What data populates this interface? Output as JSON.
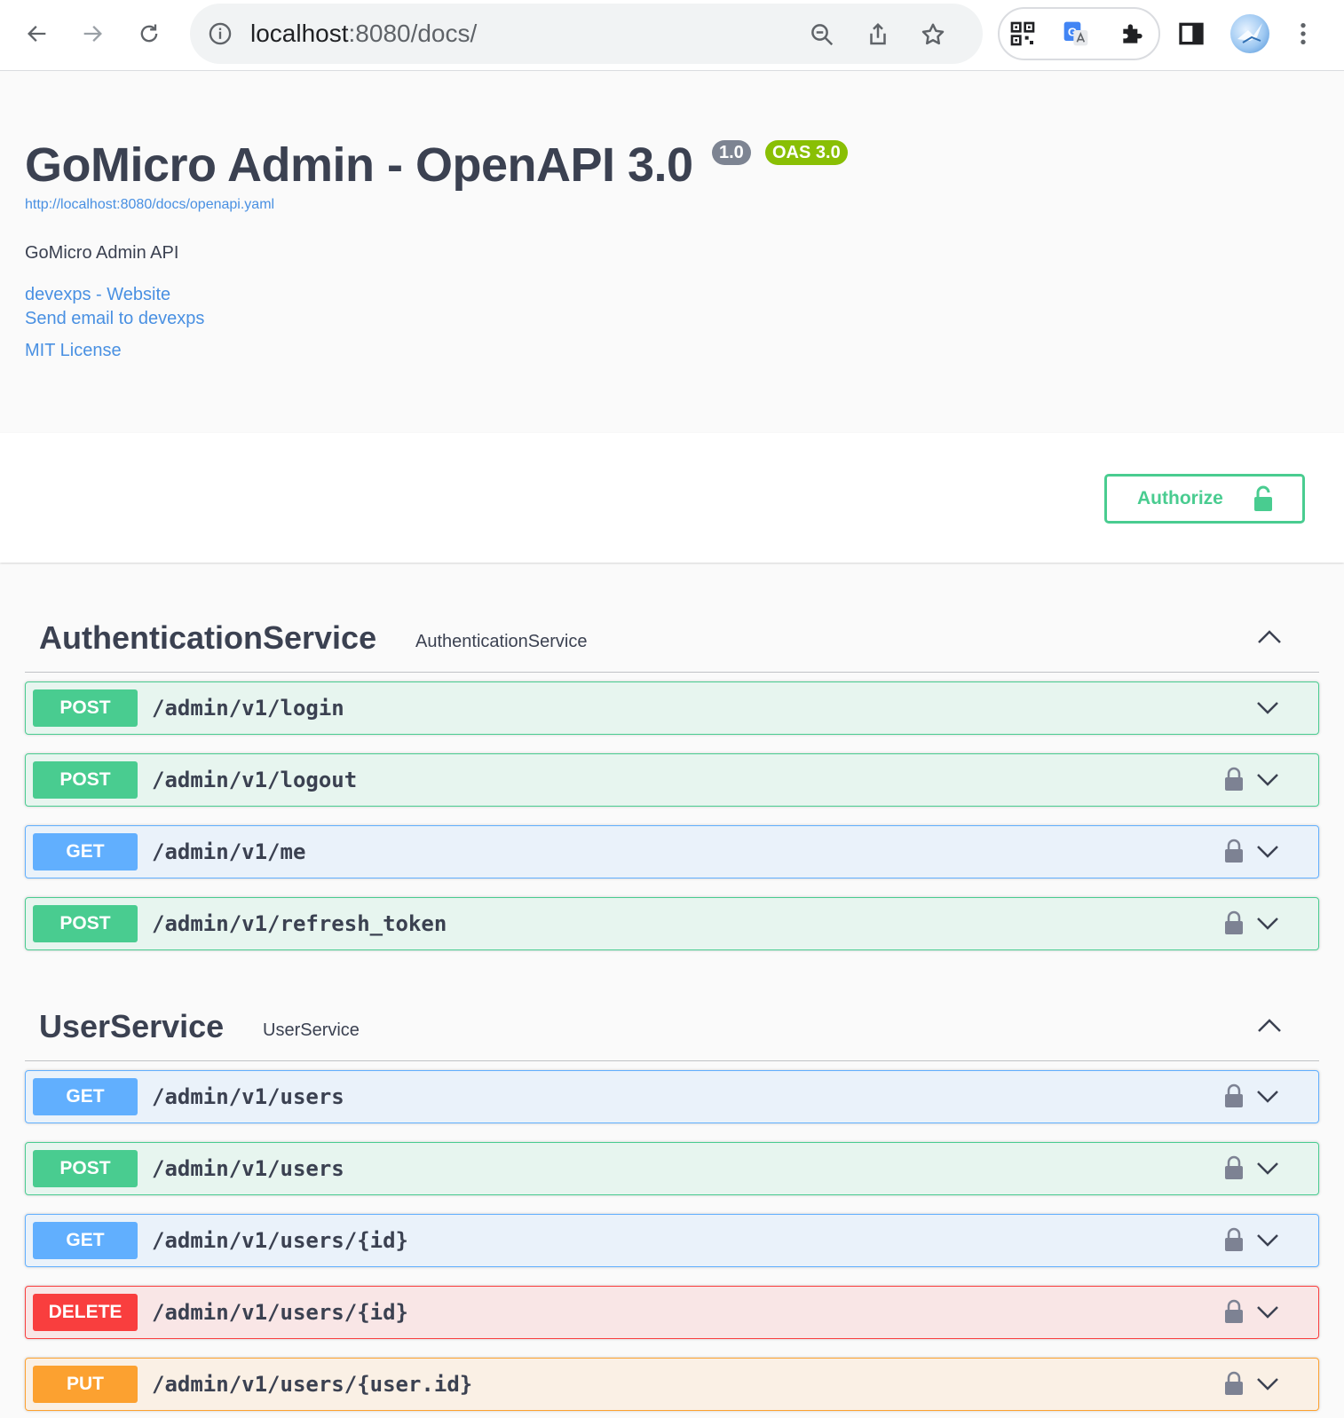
{
  "browser": {
    "url_host": "localhost",
    "url_rest": ":8080/docs/",
    "icons": [
      "back-icon",
      "forward-icon",
      "reload-icon",
      "info-icon",
      "zoom-icon",
      "share-icon",
      "bookmark-star-icon",
      "qr-code-icon",
      "translate-icon",
      "extensions-puzzle-icon",
      "side-panel-icon",
      "profile-avatar",
      "more-menu-icon"
    ]
  },
  "info": {
    "title": "GoMicro Admin - OpenAPI 3.0",
    "version_badge": "1.0",
    "oas_badge": "OAS 3.0",
    "spec_url": "http://localhost:8080/docs/openapi.yaml",
    "description": "GoMicro Admin API",
    "website_link": "devexps - Website",
    "email_link": "Send email to devexps",
    "license_link": "MIT License"
  },
  "scheme": {
    "authorize_label": "Authorize"
  },
  "tags": [
    {
      "name": "AuthenticationService",
      "description": "AuthenticationService",
      "operations": [
        {
          "method": "POST",
          "path": "/admin/v1/login",
          "locked": false
        },
        {
          "method": "POST",
          "path": "/admin/v1/logout",
          "locked": true
        },
        {
          "method": "GET",
          "path": "/admin/v1/me",
          "locked": true
        },
        {
          "method": "POST",
          "path": "/admin/v1/refresh_token",
          "locked": true
        }
      ]
    },
    {
      "name": "UserService",
      "description": "UserService",
      "operations": [
        {
          "method": "GET",
          "path": "/admin/v1/users",
          "locked": true
        },
        {
          "method": "POST",
          "path": "/admin/v1/users",
          "locked": true
        },
        {
          "method": "GET",
          "path": "/admin/v1/users/{id}",
          "locked": true
        },
        {
          "method": "DELETE",
          "path": "/admin/v1/users/{id}",
          "locked": true
        },
        {
          "method": "PUT",
          "path": "/admin/v1/users/{user.id}",
          "locked": true
        }
      ]
    }
  ],
  "colors": {
    "post": "#49cc90",
    "get": "#61affe",
    "delete": "#f93e3e",
    "put": "#fca130",
    "link": "#4990e2",
    "text": "#3b4151"
  }
}
